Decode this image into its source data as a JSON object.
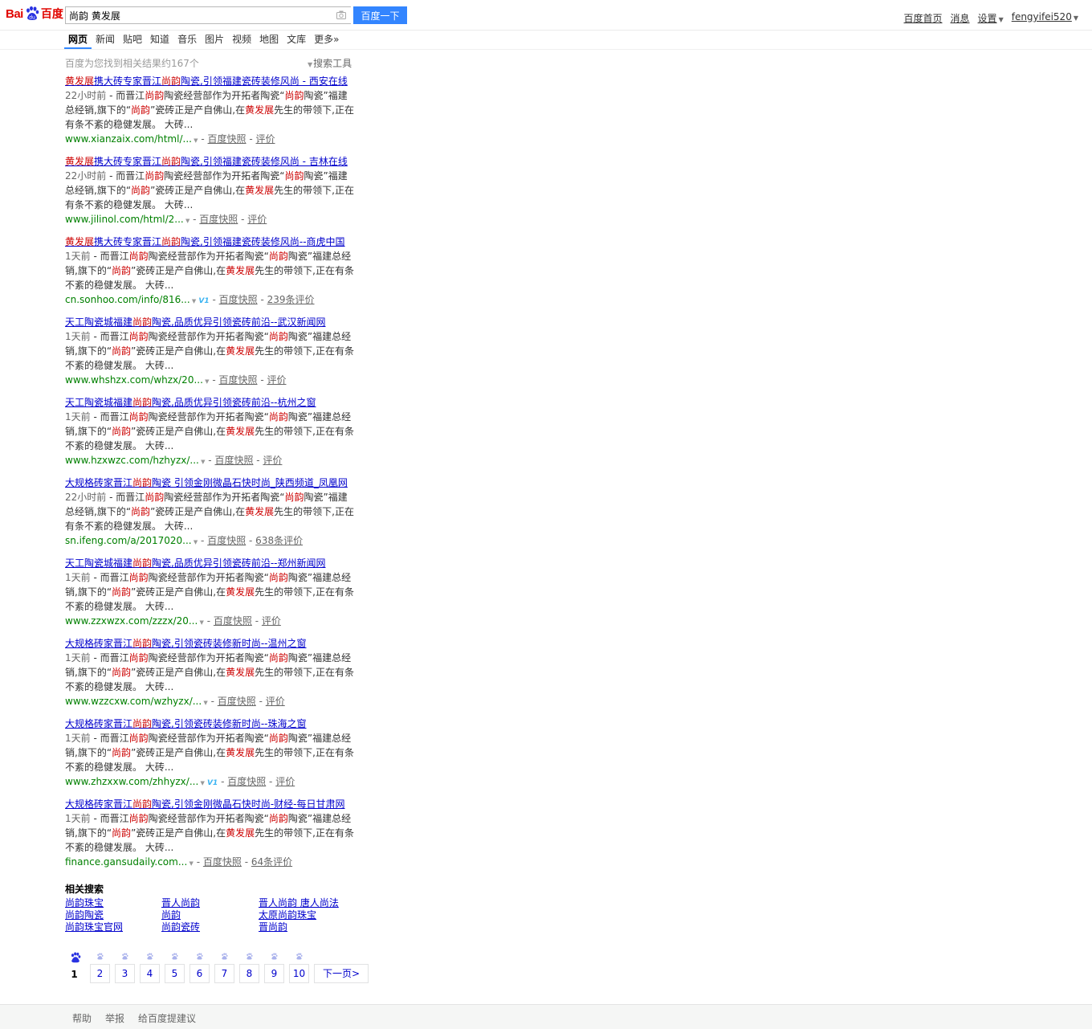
{
  "header": {
    "logo_bai": "Bai",
    "logo_du": "百度",
    "search_value": "尚韵 黄发展",
    "search_button": "百度一下",
    "user_links": [
      "百度首页",
      "消息",
      "设置",
      "fengyifei520"
    ]
  },
  "tabs": [
    "网页",
    "新闻",
    "贴吧",
    "知道",
    "音乐",
    "图片",
    "视频",
    "地图",
    "文库",
    "更多»"
  ],
  "result_count": "百度为您找到相关结果约167个",
  "search_tools": "搜索工具",
  "results": [
    {
      "title": [
        [
          "em",
          "黄发展"
        ],
        [
          "t",
          "携大砖专家晋江"
        ],
        [
          "em",
          "尚韵"
        ],
        [
          "t",
          "陶瓷,引领福建瓷砖装修风尚 - 西安在线"
        ]
      ],
      "date": "22小时前",
      "abstract": [
        [
          "t",
          " - 而晋江"
        ],
        [
          "em",
          "尚韵"
        ],
        [
          "t",
          "陶瓷经营部作为开拓者陶瓷“"
        ],
        [
          "em",
          "尚韵"
        ],
        [
          "t",
          "陶瓷”福建总经销,旗下的“"
        ],
        [
          "em",
          "尚韵"
        ],
        [
          "t",
          "”瓷砖正是产自佛山,在"
        ],
        [
          "em",
          "黄发展"
        ],
        [
          "t",
          "先生的带领下,正在有条不紊的稳健发展。 大砖..."
        ]
      ],
      "url": "www.xianzaix.com/html/...",
      "v1": false,
      "snapshot": "百度快照",
      "review": "评价"
    },
    {
      "title": [
        [
          "em",
          "黄发展"
        ],
        [
          "t",
          "携大砖专家晋江"
        ],
        [
          "em",
          "尚韵"
        ],
        [
          "t",
          "陶瓷,引领福建瓷砖装修风尚 - 吉林在线"
        ]
      ],
      "date": "22小时前",
      "abstract": [
        [
          "t",
          " - 而晋江"
        ],
        [
          "em",
          "尚韵"
        ],
        [
          "t",
          "陶瓷经营部作为开拓者陶瓷“"
        ],
        [
          "em",
          "尚韵"
        ],
        [
          "t",
          "陶瓷”福建总经销,旗下的“"
        ],
        [
          "em",
          "尚韵"
        ],
        [
          "t",
          "”瓷砖正是产自佛山,在"
        ],
        [
          "em",
          "黄发展"
        ],
        [
          "t",
          "先生的带领下,正在有条不紊的稳健发展。 大砖..."
        ]
      ],
      "url": "www.jilinol.com/html/2...",
      "v1": false,
      "snapshot": "百度快照",
      "review": "评价"
    },
    {
      "title": [
        [
          "em",
          "黄发展"
        ],
        [
          "t",
          "携大砖专家晋江"
        ],
        [
          "em",
          "尚韵"
        ],
        [
          "t",
          "陶瓷,引领福建瓷砖装修风尚--商虎中国"
        ]
      ],
      "date": "1天前",
      "abstract": [
        [
          "t",
          " - 而晋江"
        ],
        [
          "em",
          "尚韵"
        ],
        [
          "t",
          "陶瓷经营部作为开拓者陶瓷“"
        ],
        [
          "em",
          "尚韵"
        ],
        [
          "t",
          "陶瓷”福建总经销,旗下的“"
        ],
        [
          "em",
          "尚韵"
        ],
        [
          "t",
          "”瓷砖正是产自佛山,在"
        ],
        [
          "em",
          "黄发展"
        ],
        [
          "t",
          "先生的带领下,正在有条不紊的稳健发展。 大砖..."
        ]
      ],
      "url": "cn.sonhoo.com/info/816...",
      "v1": true,
      "snapshot": "百度快照",
      "review": "239条评价"
    },
    {
      "title": [
        [
          "t",
          "天工陶瓷城福建"
        ],
        [
          "em",
          "尚韵"
        ],
        [
          "t",
          "陶瓷,品质优异引领瓷砖前沿--武汉新闻网"
        ]
      ],
      "date": "1天前",
      "abstract": [
        [
          "t",
          " - 而晋江"
        ],
        [
          "em",
          "尚韵"
        ],
        [
          "t",
          "陶瓷经营部作为开拓者陶瓷“"
        ],
        [
          "em",
          "尚韵"
        ],
        [
          "t",
          "陶瓷”福建总经销,旗下的“"
        ],
        [
          "em",
          "尚韵"
        ],
        [
          "t",
          "”瓷砖正是产自佛山,在"
        ],
        [
          "em",
          "黄发展"
        ],
        [
          "t",
          "先生的带领下,正在有条不紊的稳健发展。 大砖..."
        ]
      ],
      "url": "www.whshzx.com/whzx/20...",
      "v1": false,
      "snapshot": "百度快照",
      "review": "评价"
    },
    {
      "title": [
        [
          "t",
          "天工陶瓷城福建"
        ],
        [
          "em",
          "尚韵"
        ],
        [
          "t",
          "陶瓷,品质优异引领瓷砖前沿--杭州之窗"
        ]
      ],
      "date": "1天前",
      "abstract": [
        [
          "t",
          " - 而晋江"
        ],
        [
          "em",
          "尚韵"
        ],
        [
          "t",
          "陶瓷经营部作为开拓者陶瓷“"
        ],
        [
          "em",
          "尚韵"
        ],
        [
          "t",
          "陶瓷”福建总经销,旗下的“"
        ],
        [
          "em",
          "尚韵"
        ],
        [
          "t",
          "”瓷砖正是产自佛山,在"
        ],
        [
          "em",
          "黄发展"
        ],
        [
          "t",
          "先生的带领下,正在有条不紊的稳健发展。 大砖..."
        ]
      ],
      "url": "www.hzxwzc.com/hzhyzx/...",
      "v1": false,
      "snapshot": "百度快照",
      "review": "评价"
    },
    {
      "title": [
        [
          "t",
          "大规格砖家晋江"
        ],
        [
          "em",
          "尚韵"
        ],
        [
          "t",
          "陶瓷 引领金刚微晶石快时尚_陕西频道_凤凰网"
        ]
      ],
      "date": "22小时前",
      "abstract": [
        [
          "t",
          " - 而晋江"
        ],
        [
          "em",
          "尚韵"
        ],
        [
          "t",
          "陶瓷经营部作为开拓者陶瓷“"
        ],
        [
          "em",
          "尚韵"
        ],
        [
          "t",
          "陶瓷”福建总经销,旗下的“"
        ],
        [
          "em",
          "尚韵"
        ],
        [
          "t",
          "”瓷砖正是产自佛山,在"
        ],
        [
          "em",
          "黄发展"
        ],
        [
          "t",
          "先生的带领下,正在有条不紊的稳健发展。 大砖..."
        ]
      ],
      "url": "sn.ifeng.com/a/2017020...",
      "v1": false,
      "snapshot": "百度快照",
      "review": "638条评价"
    },
    {
      "title": [
        [
          "t",
          "天工陶瓷城福建"
        ],
        [
          "em",
          "尚韵"
        ],
        [
          "t",
          "陶瓷,品质优异引领瓷砖前沿--郑州新闻网"
        ]
      ],
      "date": "1天前",
      "abstract": [
        [
          "t",
          " - 而晋江"
        ],
        [
          "em",
          "尚韵"
        ],
        [
          "t",
          "陶瓷经营部作为开拓者陶瓷“"
        ],
        [
          "em",
          "尚韵"
        ],
        [
          "t",
          "陶瓷”福建总经销,旗下的“"
        ],
        [
          "em",
          "尚韵"
        ],
        [
          "t",
          "”瓷砖正是产自佛山,在"
        ],
        [
          "em",
          "黄发展"
        ],
        [
          "t",
          "先生的带领下,正在有条不紊的稳健发展。 大砖..."
        ]
      ],
      "url": "www.zzxwzx.com/zzzx/20...",
      "v1": false,
      "snapshot": "百度快照",
      "review": "评价"
    },
    {
      "title": [
        [
          "t",
          "大规格砖家晋江"
        ],
        [
          "em",
          "尚韵"
        ],
        [
          "t",
          "陶瓷,引领瓷砖装修新时尚--温州之窗"
        ]
      ],
      "date": "1天前",
      "abstract": [
        [
          "t",
          " - 而晋江"
        ],
        [
          "em",
          "尚韵"
        ],
        [
          "t",
          "陶瓷经营部作为开拓者陶瓷“"
        ],
        [
          "em",
          "尚韵"
        ],
        [
          "t",
          "陶瓷”福建总经销,旗下的“"
        ],
        [
          "em",
          "尚韵"
        ],
        [
          "t",
          "”瓷砖正是产自佛山,在"
        ],
        [
          "em",
          "黄发展"
        ],
        [
          "t",
          "先生的带领下,正在有条不紊的稳健发展。 大砖..."
        ]
      ],
      "url": "www.wzzcxw.com/wzhyzx/...",
      "v1": false,
      "snapshot": "百度快照",
      "review": "评价"
    },
    {
      "title": [
        [
          "t",
          "大规格砖家晋江"
        ],
        [
          "em",
          "尚韵"
        ],
        [
          "t",
          "陶瓷,引领瓷砖装修新时尚--珠海之窗"
        ]
      ],
      "date": "1天前",
      "abstract": [
        [
          "t",
          " - 而晋江"
        ],
        [
          "em",
          "尚韵"
        ],
        [
          "t",
          "陶瓷经营部作为开拓者陶瓷“"
        ],
        [
          "em",
          "尚韵"
        ],
        [
          "t",
          "陶瓷”福建总经销,旗下的“"
        ],
        [
          "em",
          "尚韵"
        ],
        [
          "t",
          "”瓷砖正是产自佛山,在"
        ],
        [
          "em",
          "黄发展"
        ],
        [
          "t",
          "先生的带领下,正在有条不紊的稳健发展。 大砖..."
        ]
      ],
      "url": "www.zhzxxw.com/zhhyzx/...",
      "v1": true,
      "snapshot": "百度快照",
      "review": "评价"
    },
    {
      "title": [
        [
          "t",
          "大规格砖家晋江"
        ],
        [
          "em",
          "尚韵"
        ],
        [
          "t",
          "陶瓷,引领金刚微晶石快时尚-财经-每日甘肃网"
        ]
      ],
      "date": "1天前",
      "abstract": [
        [
          "t",
          " - 而晋江"
        ],
        [
          "em",
          "尚韵"
        ],
        [
          "t",
          "陶瓷经营部作为开拓者陶瓷“"
        ],
        [
          "em",
          "尚韵"
        ],
        [
          "t",
          "陶瓷”福建总经销,旗下的“"
        ],
        [
          "em",
          "尚韵"
        ],
        [
          "t",
          "”瓷砖正是产自佛山,在"
        ],
        [
          "em",
          "黄发展"
        ],
        [
          "t",
          "先生的带领下,正在有条不紊的稳健发展。 大砖..."
        ]
      ],
      "url": "finance.gansudaily.com...",
      "v1": false,
      "snapshot": "百度快照",
      "review": "64条评价"
    }
  ],
  "related": {
    "title": "相关搜索",
    "items": [
      "尚韵珠宝",
      "晋人尚韵",
      "晋人尚韵 唐人尚法",
      "尚韵陶瓷",
      "尚韵",
      "太原尚韵珠宝",
      "尚韵珠宝官网",
      "尚韵瓷砖",
      "晋尚韵"
    ]
  },
  "pager": {
    "pages": [
      "1",
      "2",
      "3",
      "4",
      "5",
      "6",
      "7",
      "8",
      "9",
      "10"
    ],
    "current": "1",
    "next": "下一页>"
  },
  "footer": [
    "帮助",
    "举报",
    "给百度提建议"
  ],
  "colors": {
    "accent": "#3385ff",
    "highlight": "#cc0000",
    "link": "#0000cc",
    "url": "#008000"
  }
}
